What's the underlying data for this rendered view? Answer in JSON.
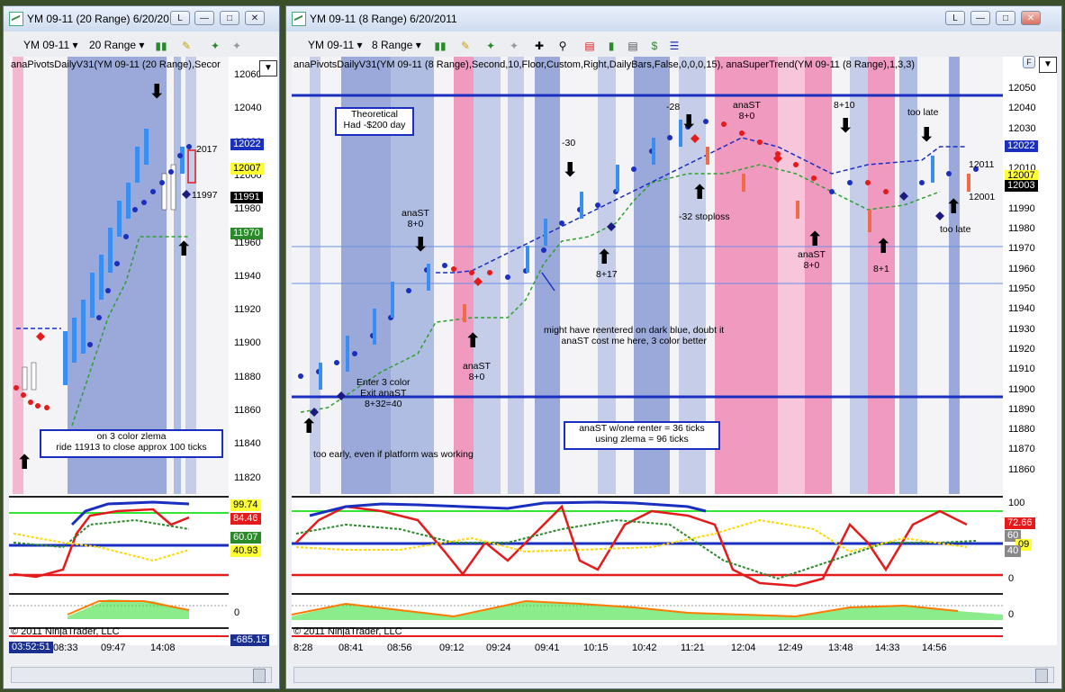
{
  "left_window": {
    "title": "YM 09-11 (20 Range)  6/20/20",
    "instrument": "YM 09-11",
    "period": "20 Range",
    "indicator_header": "anaPivotsDailyV31(YM 09-11 (20 Range),Secor",
    "price_ticks": [
      "12060",
      "12040",
      "12020",
      "12000",
      "11980",
      "11960",
      "11940",
      "11920",
      "11900",
      "11880",
      "11860",
      "11840",
      "11820"
    ],
    "price_tags": {
      "a": "12022",
      "b": "12007",
      "c": "11991",
      "d": "11970"
    },
    "chart_labels": {
      "p1": "2017",
      "p2": "11997"
    },
    "note": "on 3 color zlema\nride 11913 to close approx 100 ticks",
    "osc_tags": {
      "a": "99.74",
      "b": "84.46",
      "c": "60.07",
      "d": "40.93"
    },
    "osc_ticks": {
      "a": "100",
      "b": "0"
    },
    "copyright": "© 2011 NinjaTrader, LLC",
    "bottom_value": "-685.15",
    "clock": "03:52:51",
    "x_labels": [
      "08:33",
      "09:47",
      "14:08"
    ]
  },
  "right_window": {
    "title": "YM 09-11 (8 Range)  6/20/2011",
    "instrument": "YM 09-11",
    "period": "8 Range",
    "indicator_header": "anaPivotsDailyV31(YM 09-11 (8 Range),Second,10,Floor,Custom,Right,DailyBars,False,0,0,0,15), anaSuperTrend(YM 09-11 (8 Range),1,3,3)",
    "price_ticks": [
      "12050",
      "12040",
      "12030",
      "12020",
      "12010",
      "12000",
      "11990",
      "11980",
      "11970",
      "11960",
      "11950",
      "11940",
      "11930",
      "11920",
      "11910",
      "11900",
      "11890",
      "11880",
      "11870",
      "11860"
    ],
    "price_tags": {
      "a": "12022",
      "b": "12007",
      "c": "12003"
    },
    "chart_labels": {
      "p1": "12011",
      "p2": "12001"
    },
    "notes": {
      "theoretical": "Theoretical\nHad -$200 day",
      "anast_w": "anaST w/one renter = 36 ticks\nusing zlema = 96 ticks",
      "too_early": "too early, even if platform was working",
      "enter": "Enter 3 color\nExit anaST\n8+32=40",
      "might": "might have reentered on dark blue, doubt it\nanaST cost me here, 3 color better",
      "anast1": "anaST\n8+0",
      "anast2": "anaST\n8+0",
      "anast3": "anaST\n8+0",
      "anast4": "anaST\n8+0",
      "n30": "-30",
      "n28": "-28",
      "n817": "8+17",
      "stoploss": "-32 stoploss",
      "n810": "8+10",
      "n81": "8+1",
      "toolate1": "too late",
      "toolate2": "too late"
    },
    "osc_tags": {
      "a": "72.66",
      "b": "60",
      "c": "09",
      "d": "40"
    },
    "osc_ticks": {
      "a": "100",
      "b": "0",
      "c": "0"
    },
    "copyright": "© 2011 NinjaTrader, LLC",
    "x_labels": [
      "8:28",
      "08:41",
      "08:56",
      "09:12",
      "09:24",
      "09:41",
      "10:15",
      "10:42",
      "11:21",
      "12:04",
      "12:49",
      "13:48",
      "14:33",
      "14:56"
    ]
  },
  "icons": [
    "chart-icon",
    "bars-icon",
    "pencil-icon",
    "pin-icon",
    "crosshair-icon",
    "zoom-icon",
    "properties-icon",
    "dollar-icon"
  ]
}
